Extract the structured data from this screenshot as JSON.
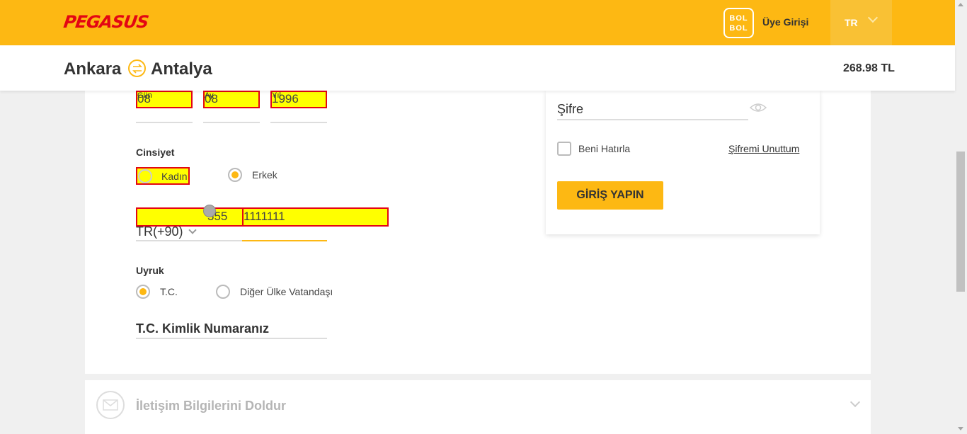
{
  "header": {
    "logo": "PEGASUS",
    "bolbol_line1": "BOL",
    "bolbol_line2": "BOL",
    "member_login": "Üye Girişi",
    "language": "TR"
  },
  "route": {
    "from": "Ankara",
    "to": "Antalya",
    "price": "268.98 TL"
  },
  "birthdate": {
    "day_label": "Gün",
    "day_value": "08",
    "month_label": "Ay",
    "month_value": "08",
    "year_label": "Yıl",
    "year_value": "1996"
  },
  "gender": {
    "label": "Cinsiyet",
    "options": [
      "Kadın",
      "Erkek"
    ],
    "selected": "Erkek"
  },
  "phone": {
    "country_code": "TR(+90)",
    "area_code": "555",
    "number": "1111111"
  },
  "nationality": {
    "label": "Uyruk",
    "options": [
      "T.C.",
      "Diğer Ülke Vatandaşı"
    ],
    "selected": "T.C."
  },
  "tc_id": {
    "placeholder": "T.C. Kimlik Numaranız"
  },
  "login": {
    "password_label": "Şifre",
    "remember_me": "Beni Hatırla",
    "forgot_password": "Şifremi Unuttum",
    "submit": "GİRİŞ YAPIN"
  },
  "contact_section": {
    "title": "İletişim Bilgilerini Doldur"
  },
  "colors": {
    "brand_yellow": "#fdb813",
    "brand_red": "#e30613",
    "highlight": "#ffff00"
  }
}
